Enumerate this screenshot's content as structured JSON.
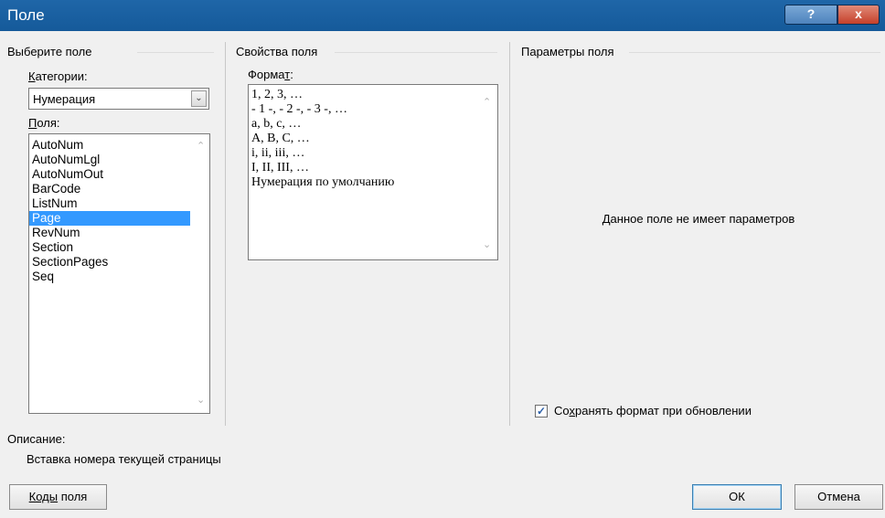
{
  "window": {
    "title": "Поле",
    "help_label": "?",
    "close_label": "x"
  },
  "select_field": {
    "group_label": "Выберите поле",
    "categories_label_u": "К",
    "categories_label_rest": "атегории:",
    "category_value": "Нумерация",
    "fields_label_u": "П",
    "fields_label_rest": "оля:",
    "fields": [
      "AutoNum",
      "AutoNumLgl",
      "AutoNumOut",
      "BarCode",
      "ListNum",
      "Page",
      "RevNum",
      "Section",
      "SectionPages",
      "Seq"
    ],
    "selected_field": "Page"
  },
  "field_properties": {
    "group_label": "Свойства поля",
    "format_label_a": "Форма",
    "format_label_u": "т",
    "format_label_b": ":",
    "formats": [
      "1, 2, 3, …",
      "- 1 -, - 2 -, - 3 -, …",
      "a, b, c, …",
      "A, B, C, …",
      "i, ii, iii, …",
      "I, II, III, …",
      "Нумерация по умолчанию"
    ]
  },
  "field_options": {
    "group_label": "Параметры поля",
    "no_params_text": "Данное поле не имеет параметров",
    "preserve_a": "Со",
    "preserve_u": "х",
    "preserve_b": "ранять формат при обновлении",
    "preserve_checked": true
  },
  "description": {
    "label": "Описание:",
    "text": "Вставка номера текущей страницы"
  },
  "buttons": {
    "field_codes_u": "Коды",
    "field_codes_rest": " поля",
    "ok": "ОК",
    "cancel": "Отмена"
  }
}
